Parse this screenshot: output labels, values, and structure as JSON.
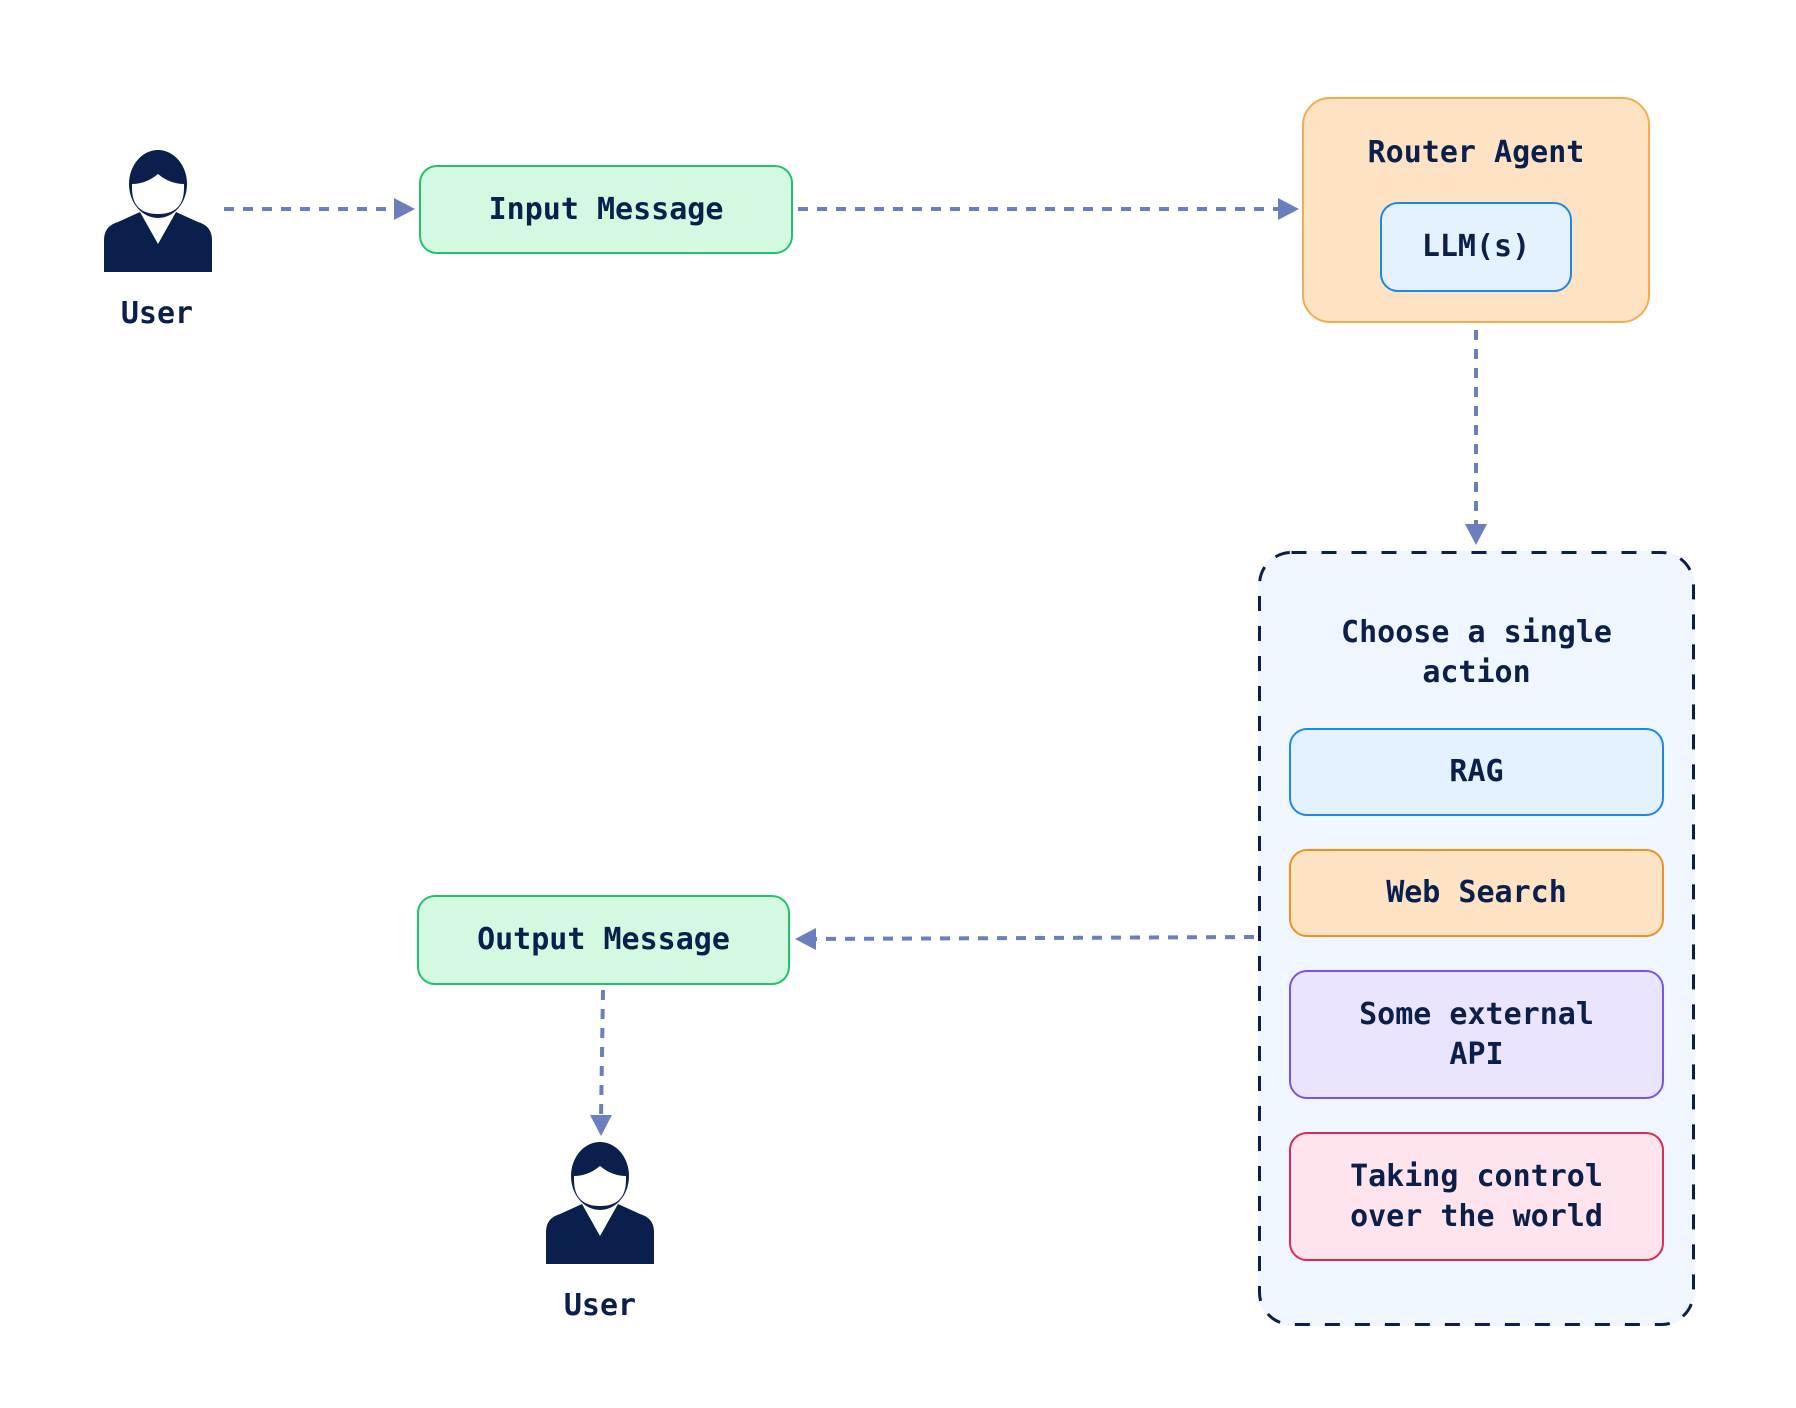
{
  "diagram": {
    "user_top": {
      "icon": "user-icon",
      "label": "User"
    },
    "input_message": {
      "label": "Input Message"
    },
    "router_agent": {
      "title": "Router Agent",
      "llm_label": "LLM(s)"
    },
    "action_group": {
      "title_line1": "Choose a single",
      "title_line2": "action",
      "actions": [
        {
          "line1": "RAG",
          "line2": ""
        },
        {
          "line1": "Web Search",
          "line2": ""
        },
        {
          "line1": "Some external",
          "line2": "API"
        },
        {
          "line1": "Taking control",
          "line2": "over the world"
        }
      ]
    },
    "output_message": {
      "label": "Output Message"
    },
    "user_bottom": {
      "icon": "user-icon",
      "label": "User"
    },
    "edges": [
      {
        "from": "User",
        "to": "Input Message"
      },
      {
        "from": "Input Message",
        "to": "Router Agent"
      },
      {
        "from": "Router Agent",
        "to": "Choose a single action"
      },
      {
        "from": "Choose a single action",
        "to": "Output Message"
      },
      {
        "from": "Output Message",
        "to": "User"
      }
    ],
    "colors": {
      "text": "#0b1f4d",
      "arrow": "#6b7fbf",
      "message_fill": "#d3f9e0",
      "message_border": "#22c16b",
      "router_fill": "#fde3c4",
      "router_border": "#f5ac4e",
      "llm_fill": "#e4f1ff",
      "llm_border": "#1e88e5",
      "container_fill": "#f0f6ff",
      "container_border": "#0b1f4d",
      "rag_border": "#1e88e5",
      "web_border": "#f0901e",
      "api_border": "#7a54e6",
      "control_border": "#dc2a52"
    }
  }
}
